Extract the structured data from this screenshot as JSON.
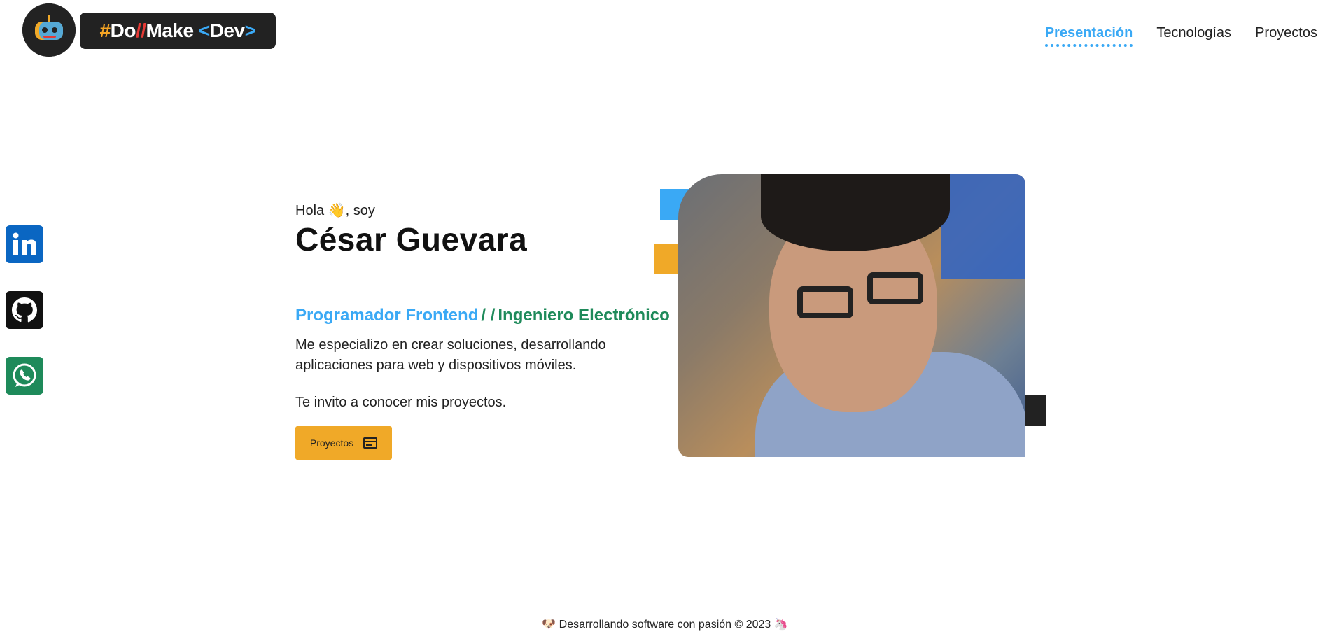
{
  "header": {
    "logo_text": {
      "hash": "#",
      "do": "Do",
      "slashes": "//",
      "make": "Make",
      "lt": "<",
      "dev": "Dev",
      "gt": ">"
    },
    "nav": [
      {
        "label": "Presentación",
        "active": true
      },
      {
        "label": "Tecnologías",
        "active": false
      },
      {
        "label": "Proyectos",
        "active": false
      }
    ]
  },
  "social": [
    {
      "icon": "linkedin-icon",
      "color": "#0a66c2"
    },
    {
      "icon": "github-icon",
      "color": "#111111"
    },
    {
      "icon": "whatsapp-icon",
      "color": "#1e8a5a"
    }
  ],
  "hero": {
    "greeting": "Hola 👋, soy",
    "name": "César Guevara",
    "role1": "Programador Frontend",
    "role_separator": "/ /",
    "role2": "Ingeniero Electrónico",
    "description": "Me especializo en crear soluciones, desarrollando aplicaciones para web y dispositivos móviles.",
    "invite": "Te invito a conocer mis proyectos.",
    "button_label": "Proyectos"
  },
  "footer": {
    "text": "🐶 Desarrollando software con pasión © 2023 🦄"
  },
  "colors": {
    "accent_blue": "#3aa9f5",
    "accent_green": "#1e8a5a",
    "accent_orange": "#f0a928",
    "dark": "#222222"
  }
}
